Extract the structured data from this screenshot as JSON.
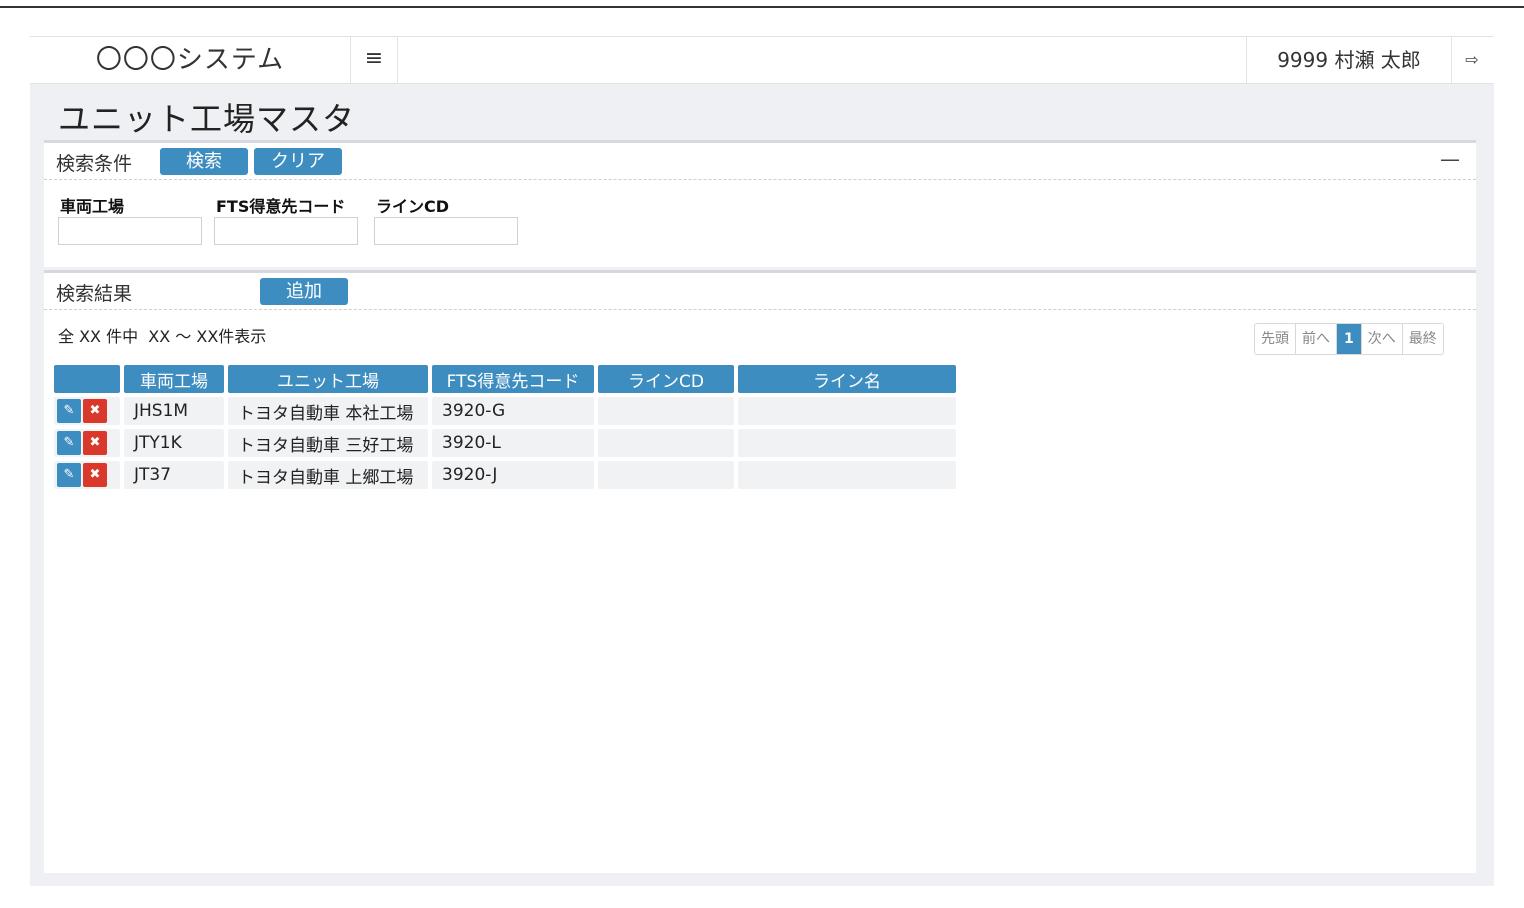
{
  "header": {
    "app_title": "〇〇〇システム",
    "menu_glyph": "≡",
    "user": "9999 村瀬 太郎",
    "logout_glyph": "⇨"
  },
  "page": {
    "title": "ユニット工場マスタ"
  },
  "search": {
    "section_label": "検索条件",
    "search_button": "検索",
    "clear_button": "クリア",
    "collapse_glyph": "—",
    "fields": [
      {
        "label": "車両工場",
        "value": ""
      },
      {
        "label": "FTS得意先コード",
        "value": ""
      },
      {
        "label": "ラインCD",
        "value": ""
      }
    ]
  },
  "results": {
    "section_label": "検索結果",
    "add_button": "追加",
    "count_text": "全 XX 件中  XX ～ XX件表示",
    "pager": {
      "first": "先頭",
      "prev": "前へ",
      "current": "1",
      "next": "次へ",
      "last": "最終"
    },
    "columns": [
      "",
      "車両工場",
      "ユニット工場",
      "FTS得意先コード",
      "ラインCD",
      "ライン名"
    ],
    "rows": [
      {
        "vehicle_factory": "JHS1M",
        "unit_factory": "トヨタ自動車 本社工場",
        "fts_code": "3920-G",
        "line_cd": "",
        "line_name": ""
      },
      {
        "vehicle_factory": "JTY1K",
        "unit_factory": "トヨタ自動車 三好工場",
        "fts_code": "3920-L",
        "line_cd": "",
        "line_name": ""
      },
      {
        "vehicle_factory": "JT37",
        "unit_factory": "トヨタ自動車 上郷工場",
        "fts_code": "3920-J",
        "line_cd": "",
        "line_name": ""
      }
    ]
  },
  "icons": {
    "edit": "edit-icon",
    "delete": "delete-icon"
  },
  "colors": {
    "accent": "#3e8dc0",
    "danger": "#d9382b",
    "background": "#eef0f4"
  }
}
